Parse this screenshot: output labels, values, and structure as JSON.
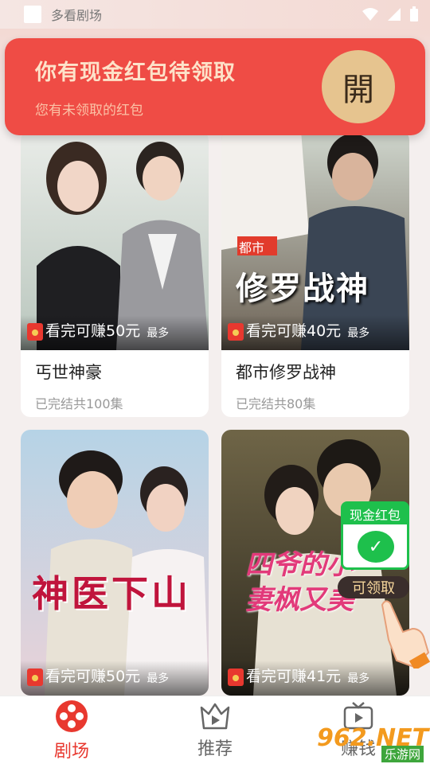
{
  "status_bar": {
    "app_name": "多看剧场"
  },
  "banner": {
    "title": "你有现金红包待领取",
    "subtitle": "您有未领取的红包",
    "open_label": "開"
  },
  "cards": [
    {
      "title": "丐世神豪",
      "meta": "已完结共100集",
      "earn": "看完可赚50元",
      "most": "最多",
      "poster_text": ""
    },
    {
      "title": "都市修罗战神",
      "meta": "已完结共80集",
      "earn": "看完可赚40元",
      "most": "最多",
      "poster_tag": "都市",
      "poster_text": "修罗战神"
    },
    {
      "title": "",
      "meta": "",
      "earn": "看完可赚50元",
      "most": "最多",
      "poster_text": "神医下山"
    },
    {
      "title": "",
      "meta": "",
      "earn": "看完可赚41元",
      "most": "最多",
      "poster_text": "四爷的小妻枫又美"
    }
  ],
  "float_redpacket": {
    "label": "现金红包",
    "claim": "可领取"
  },
  "nav": [
    {
      "label": "剧场",
      "icon": "film-reel-icon",
      "active": true
    },
    {
      "label": "推荐",
      "icon": "crown-play-icon",
      "active": false
    },
    {
      "label": "赚钱",
      "icon": "tv-play-icon",
      "active": false
    }
  ],
  "watermark": {
    "main": "962.NET",
    "sub": "乐游网"
  },
  "colors": {
    "accent": "#e8382f",
    "banner": "#ef4c45",
    "wechat": "#1ec04c"
  }
}
